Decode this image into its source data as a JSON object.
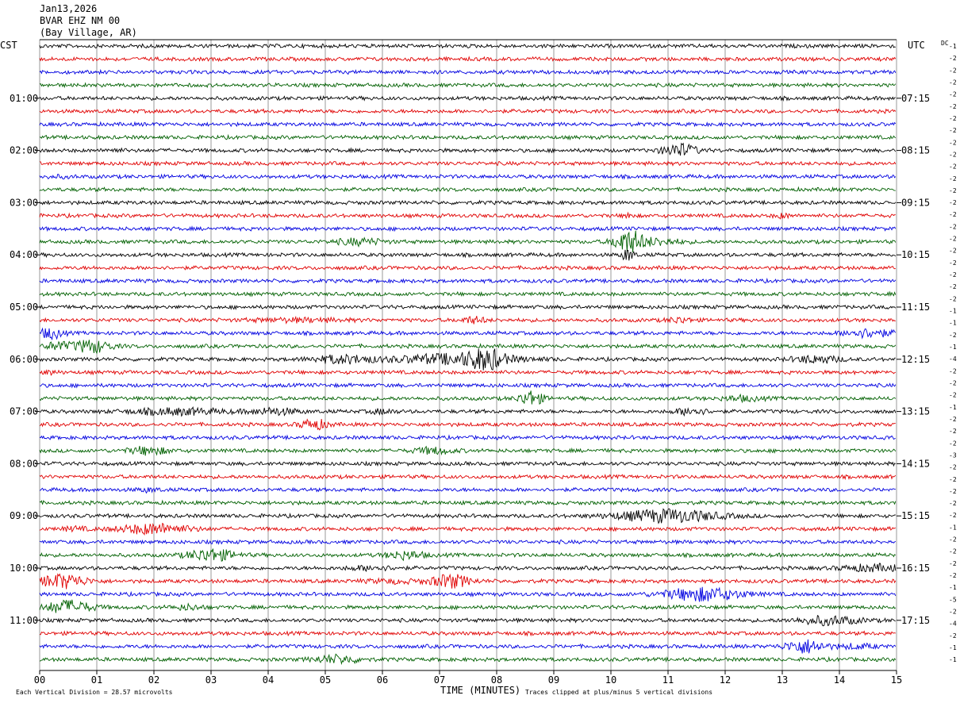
{
  "header": {
    "date": "Jan13,2026",
    "station": "BVAR EHZ NM 00",
    "location": "(Bay Village, AR)"
  },
  "axes": {
    "left_tz": "CST",
    "right_tz": "UTC",
    "dc_label": "DC",
    "xlabel": "TIME (MINUTES)",
    "footer_left": "Each Vertical Division =   28.57 microvolts",
    "footer_right": "Traces clipped at plus/minus 5 vertical divisions"
  },
  "colors": {
    "cycle": [
      "#000000",
      "#e00000",
      "#0000e0",
      "#006000"
    ],
    "grid": "#555555"
  },
  "chart_data": {
    "type": "line",
    "title": "",
    "xlabel": "TIME (MINUTES)",
    "ylabel": "",
    "xlim": [
      0,
      15
    ],
    "x_ticks": [
      "00",
      "01",
      "02",
      "03",
      "04",
      "05",
      "06",
      "07",
      "08",
      "09",
      "10",
      "11",
      "12",
      "13",
      "14",
      "15"
    ],
    "trace_count": 48,
    "cst_labels": [
      "01:00",
      "02:00",
      "03:00",
      "04:00",
      "05:00",
      "06:00",
      "07:00",
      "08:00",
      "09:00",
      "10:00",
      "11:00"
    ],
    "utc_labels": [
      "07:15",
      "08:15",
      "09:15",
      "10:15",
      "11:15",
      "12:15",
      "13:15",
      "14:15",
      "15:15",
      "16:15",
      "17:15"
    ],
    "dc_offsets": [
      -1,
      -2,
      -2,
      -2,
      -2,
      -2,
      -2,
      -2,
      -2,
      -2,
      -2,
      -2,
      -2,
      -2,
      -2,
      -2,
      -2,
      -2,
      -2,
      -2,
      -2,
      -2,
      -1,
      -1,
      -2,
      -1,
      -4,
      -2,
      -2,
      -2,
      -1,
      -2,
      -2,
      -2,
      -3,
      -2,
      -2,
      -2,
      -2,
      -2,
      -1,
      -2,
      -2,
      -2,
      -2,
      -1,
      -5,
      -2,
      -4,
      -2,
      -1,
      -1
    ],
    "events": [
      {
        "trace": 8,
        "minute": 11.2,
        "amp": 2.5,
        "width": 0.45
      },
      {
        "trace": 8,
        "minute": 1.3,
        "amp": 0.6,
        "width": 0.2
      },
      {
        "trace": 10,
        "minute": 0.3,
        "amp": 0.3,
        "width": 0.5
      },
      {
        "trace": 13,
        "minute": 13.0,
        "amp": 0.8,
        "width": 0.2
      },
      {
        "trace": 15,
        "minute": 5.6,
        "amp": 1.2,
        "width": 0.6
      },
      {
        "trace": 15,
        "minute": 10.3,
        "amp": 5,
        "width": 0.35
      },
      {
        "trace": 15,
        "minute": 10.8,
        "amp": 1.3,
        "width": 0.6
      },
      {
        "trace": 16,
        "minute": 10.3,
        "amp": 2.5,
        "width": 0.15
      },
      {
        "trace": 13,
        "minute": 10.3,
        "amp": 1.5,
        "width": 0.1
      },
      {
        "trace": 21,
        "minute": 7.6,
        "amp": 1.2,
        "width": 0.3
      },
      {
        "trace": 21,
        "minute": 11.2,
        "amp": 1.0,
        "width": 0.3
      },
      {
        "trace": 21,
        "minute": 4.5,
        "amp": 0.6,
        "width": 1.2
      },
      {
        "trace": 22,
        "minute": 0.2,
        "amp": 2.0,
        "width": 0.3
      },
      {
        "trace": 22,
        "minute": 14.5,
        "amp": 1.6,
        "width": 0.6
      },
      {
        "trace": 23,
        "minute": 0.9,
        "amp": 2.5,
        "width": 0.5
      },
      {
        "trace": 23,
        "minute": 0.3,
        "amp": 1.5,
        "width": 0.3
      },
      {
        "trace": 24,
        "minute": 5.3,
        "amp": 1.5,
        "width": 0.8
      },
      {
        "trace": 24,
        "minute": 7.3,
        "amp": 2.0,
        "width": 1.6
      },
      {
        "trace": 24,
        "minute": 7.8,
        "amp": 3.5,
        "width": 0.4
      },
      {
        "trace": 24,
        "minute": 13.6,
        "amp": 1.4,
        "width": 0.6
      },
      {
        "trace": 25,
        "minute": 0.2,
        "amp": 0.6,
        "width": 0.2
      },
      {
        "trace": 27,
        "minute": 8.6,
        "amp": 3.0,
        "width": 0.3
      },
      {
        "trace": 27,
        "minute": 12.3,
        "amp": 0.9,
        "width": 0.5
      },
      {
        "trace": 28,
        "minute": 2.4,
        "amp": 1.2,
        "width": 1.2
      },
      {
        "trace": 28,
        "minute": 4.1,
        "amp": 1.2,
        "width": 0.6
      },
      {
        "trace": 28,
        "minute": 6.0,
        "amp": 0.8,
        "width": 0.3
      },
      {
        "trace": 28,
        "minute": 11.4,
        "amp": 1.4,
        "width": 0.4
      },
      {
        "trace": 29,
        "minute": 4.8,
        "amp": 2.0,
        "width": 0.35
      },
      {
        "trace": 31,
        "minute": 1.9,
        "amp": 1.5,
        "width": 0.5
      },
      {
        "trace": 31,
        "minute": 6.9,
        "amp": 1.2,
        "width": 0.5
      },
      {
        "trace": 34,
        "minute": 1.9,
        "amp": 0.6,
        "width": 0.3
      },
      {
        "trace": 36,
        "minute": 11.0,
        "amp": 2.5,
        "width": 1.3
      },
      {
        "trace": 37,
        "minute": 2.0,
        "amp": 2.0,
        "width": 0.9
      },
      {
        "trace": 37,
        "minute": 0.6,
        "amp": 0.7,
        "width": 0.3
      },
      {
        "trace": 39,
        "minute": 3.0,
        "amp": 2.4,
        "width": 0.6
      },
      {
        "trace": 39,
        "minute": 6.4,
        "amp": 1.5,
        "width": 0.5
      },
      {
        "trace": 40,
        "minute": 5.8,
        "amp": 0.8,
        "width": 0.6
      },
      {
        "trace": 40,
        "minute": 14.6,
        "amp": 1.2,
        "width": 0.8
      },
      {
        "trace": 41,
        "minute": 0.4,
        "amp": 2.8,
        "width": 0.6
      },
      {
        "trace": 41,
        "minute": 7.2,
        "amp": 2.6,
        "width": 0.5
      },
      {
        "trace": 41,
        "minute": 6.2,
        "amp": 0.6,
        "width": 0.8
      },
      {
        "trace": 42,
        "minute": 11.6,
        "amp": 2.6,
        "width": 1.0
      },
      {
        "trace": 43,
        "minute": 0.5,
        "amp": 2.6,
        "width": 0.6
      },
      {
        "trace": 43,
        "minute": 2.6,
        "amp": 0.9,
        "width": 0.4
      },
      {
        "trace": 44,
        "minute": 13.8,
        "amp": 1.6,
        "width": 0.8
      },
      {
        "trace": 46,
        "minute": 13.4,
        "amp": 2.6,
        "width": 0.5
      },
      {
        "trace": 46,
        "minute": 14.3,
        "amp": 0.8,
        "width": 0.5
      },
      {
        "trace": 47,
        "minute": 5.2,
        "amp": 1.5,
        "width": 0.6
      }
    ]
  }
}
